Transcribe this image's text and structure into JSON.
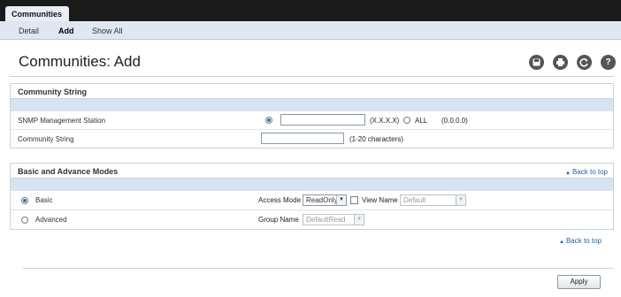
{
  "window_tab": "Communities",
  "subnav": {
    "items": [
      "Detail",
      "Add",
      "Show All"
    ],
    "active": "Add"
  },
  "page_title": "Communities: Add",
  "toolbar_icons": [
    "save-icon",
    "print-icon",
    "refresh-icon",
    "help-icon"
  ],
  "community_string_section": {
    "title": "Community String",
    "rows": {
      "snmp_station": {
        "label": "SNMP Management Station",
        "ip_value": "",
        "ip_hint": "(X.X.X.X)",
        "all_label": "ALL",
        "all_hint": "(0.0.0.0)",
        "selected": "ip"
      },
      "community_string": {
        "label": "Community String",
        "value": "",
        "hint": "(1-20 characters)"
      }
    }
  },
  "modes_section": {
    "title": "Basic and Advance Modes",
    "back_to_top": "Back to top",
    "basic": {
      "label": "Basic",
      "selected": true,
      "access_mode_label": "Access Mode",
      "access_mode_value": "ReadOnly",
      "view_name_label": "View Name",
      "view_name_checked": false,
      "view_name_value": "Default"
    },
    "advanced": {
      "label": "Advanced",
      "selected": false,
      "group_name_label": "Group Name",
      "group_name_value": "DefaultRead"
    }
  },
  "bottom_back_to_top": "Back to top",
  "apply_label": "Apply",
  "colors": {
    "accent_blue": "#1e5fa6",
    "band_blue": "#d6e4f2",
    "titlebar": "#1a1a1a"
  }
}
